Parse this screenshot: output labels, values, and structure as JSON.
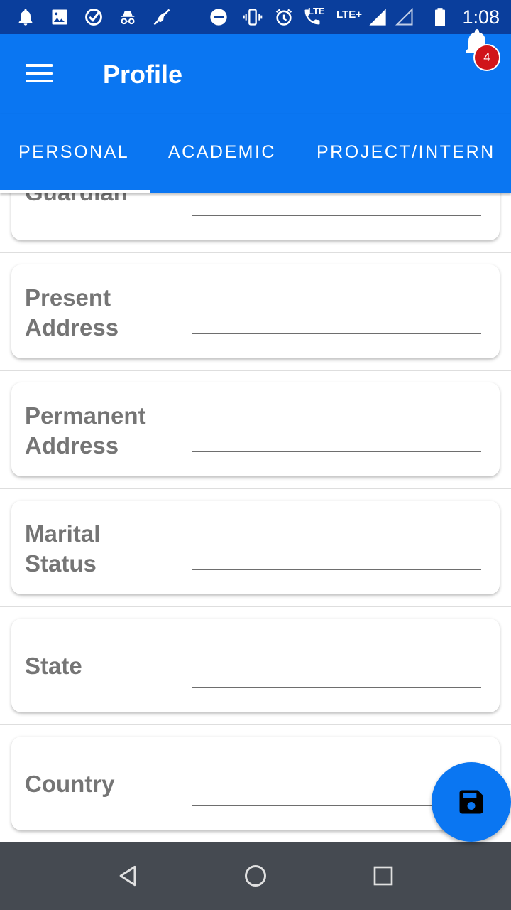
{
  "status_bar": {
    "time": "1:08",
    "net_label_1": "LTE",
    "net_label_2": "LTE+",
    "icons": [
      "notification-bell-icon",
      "image-icon",
      "check-circle-icon",
      "incognito-icon",
      "no-sync-icon",
      "do-not-disturb-icon",
      "vibrate-icon",
      "alarm-icon",
      "volte-call-icon",
      "signal-icon",
      "signal-empty-icon",
      "battery-icon"
    ]
  },
  "app_bar": {
    "title": "Profile",
    "notification_count": "4"
  },
  "tabs": [
    {
      "label": "PERSONAL",
      "selected": true
    },
    {
      "label": "ACADEMIC",
      "selected": false
    },
    {
      "label": "PROJECT/INTERN",
      "selected": false
    }
  ],
  "fields": [
    {
      "label": "Guardian",
      "value": ""
    },
    {
      "label": "Present Address",
      "value": ""
    },
    {
      "label": "Permanent Address",
      "value": ""
    },
    {
      "label": "Marital Status",
      "value": ""
    },
    {
      "label": "State",
      "value": ""
    },
    {
      "label": "Country",
      "value": ""
    }
  ],
  "fab": {
    "icon": "save-icon"
  },
  "nav": {
    "icons": [
      "back-icon",
      "home-icon",
      "recents-icon"
    ]
  },
  "colors": {
    "primary": "#0a76f2",
    "status_bar": "#0a3e9c",
    "badge": "#d0141a",
    "nav_bar": "#454a51",
    "label": "#757575"
  }
}
